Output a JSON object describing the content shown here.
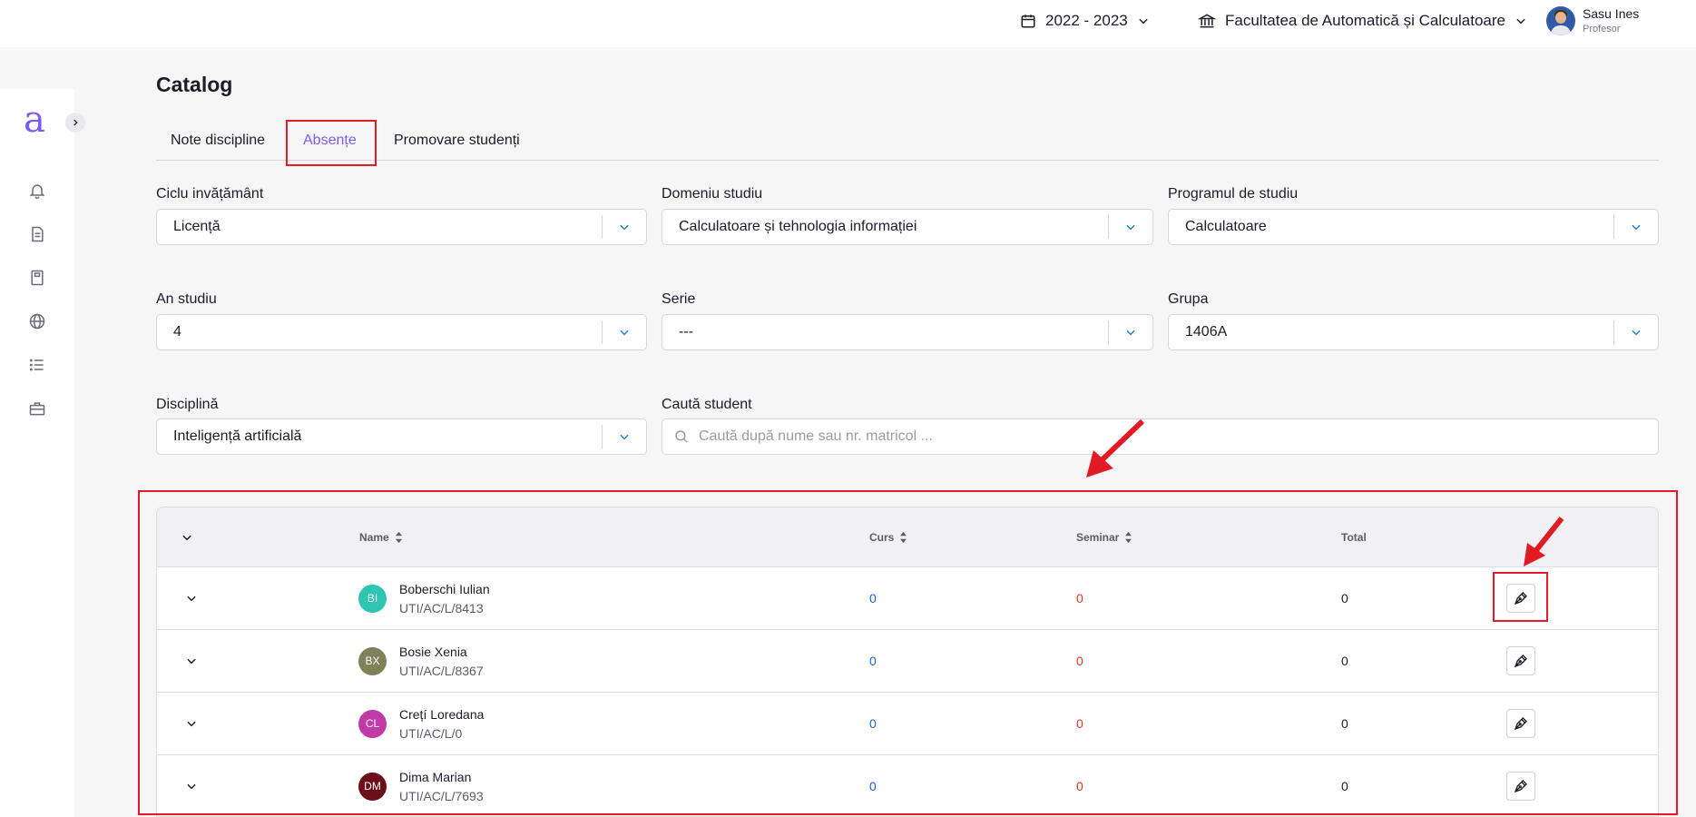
{
  "topbar": {
    "year": "2022 - 2023",
    "faculty": "Facultatea de Automatică și Calculatoare",
    "user_name": "Sasu Ines",
    "user_role": "Profesor"
  },
  "sidebar": {
    "logo": "a",
    "items": [
      "bell-icon",
      "document-icon",
      "notebook-icon",
      "globe-icon",
      "list-icon",
      "briefcase-icon"
    ]
  },
  "page": {
    "title": "Catalog",
    "tabs": [
      {
        "label": "Note discipline",
        "active": false
      },
      {
        "label": "Absențe",
        "active": true
      },
      {
        "label": "Promovare studenți",
        "active": false
      }
    ]
  },
  "filters": {
    "ciclu": {
      "label": "Ciclu invățământ",
      "value": "Licență"
    },
    "domeniu": {
      "label": "Domeniu studiu",
      "value": "Calculatoare și tehnologia informației"
    },
    "program": {
      "label": "Programul de studiu",
      "value": "Calculatoare"
    },
    "an": {
      "label": "An studiu",
      "value": "4"
    },
    "serie": {
      "label": "Serie",
      "value": "---"
    },
    "grupa": {
      "label": "Grupa",
      "value": "1406A"
    },
    "disciplina": {
      "label": "Disciplină",
      "value": "Inteligență artificială"
    },
    "search": {
      "label": "Caută student",
      "placeholder": "Caută după nume sau nr. matricol ..."
    }
  },
  "table": {
    "columns": {
      "name": "Name",
      "curs": "Curs",
      "seminar": "Seminar",
      "total": "Total"
    },
    "rows": [
      {
        "initials": "BI",
        "color": "#2fc5b3",
        "name": "Boberschi Iulian",
        "id": "UTI/AC/L/8413",
        "curs": "0",
        "seminar": "0",
        "total": "0"
      },
      {
        "initials": "BX",
        "color": "#7f8159",
        "name": "Bosie Xenia",
        "id": "UTI/AC/L/8367",
        "curs": "0",
        "seminar": "0",
        "total": "0"
      },
      {
        "initials": "CL",
        "color": "#c13aa6",
        "name": "Crețí Loredana",
        "id": "UTI/AC/L/0",
        "curs": "0",
        "seminar": "0",
        "total": "0"
      },
      {
        "initials": "DM",
        "color": "#6b0f1a",
        "name": "Dima Marian",
        "id": "UTI/AC/L/7693",
        "curs": "0",
        "seminar": "0",
        "total": "0"
      }
    ]
  },
  "colors": {
    "accent": "#7b5cf0",
    "annotation": "#e01b24",
    "curs": "#1f62d6",
    "seminar": "#d93a1f"
  }
}
